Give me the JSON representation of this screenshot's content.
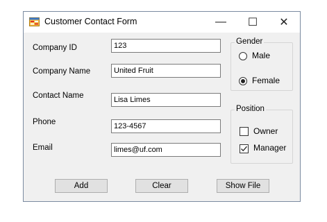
{
  "window": {
    "title": "Customer Contact Form",
    "minimize_glyph": "—",
    "maximize_glyph": "☐",
    "close_glyph": "✕"
  },
  "fields": {
    "company_id": {
      "label": "Company ID",
      "value": "123"
    },
    "company_name": {
      "label": "Company Name",
      "value": "United Fruit"
    },
    "contact_name": {
      "label": "Contact Name",
      "value": "Lisa Limes"
    },
    "phone": {
      "label": "Phone",
      "value": "123-4567"
    },
    "email": {
      "label": "Email",
      "value": "limes@uf.com"
    }
  },
  "gender": {
    "title": "Gender",
    "options": [
      {
        "label": "Male",
        "selected": false
      },
      {
        "label": "Female",
        "selected": true
      }
    ]
  },
  "position": {
    "title": "Position",
    "options": [
      {
        "label": "Owner",
        "checked": false
      },
      {
        "label": "Manager",
        "checked": true
      }
    ]
  },
  "buttons": {
    "add": "Add",
    "clear": "Clear",
    "show_file": "Show File"
  },
  "colors": {
    "form_background": "#f0f0f0",
    "button_face": "#e1e1e1"
  }
}
